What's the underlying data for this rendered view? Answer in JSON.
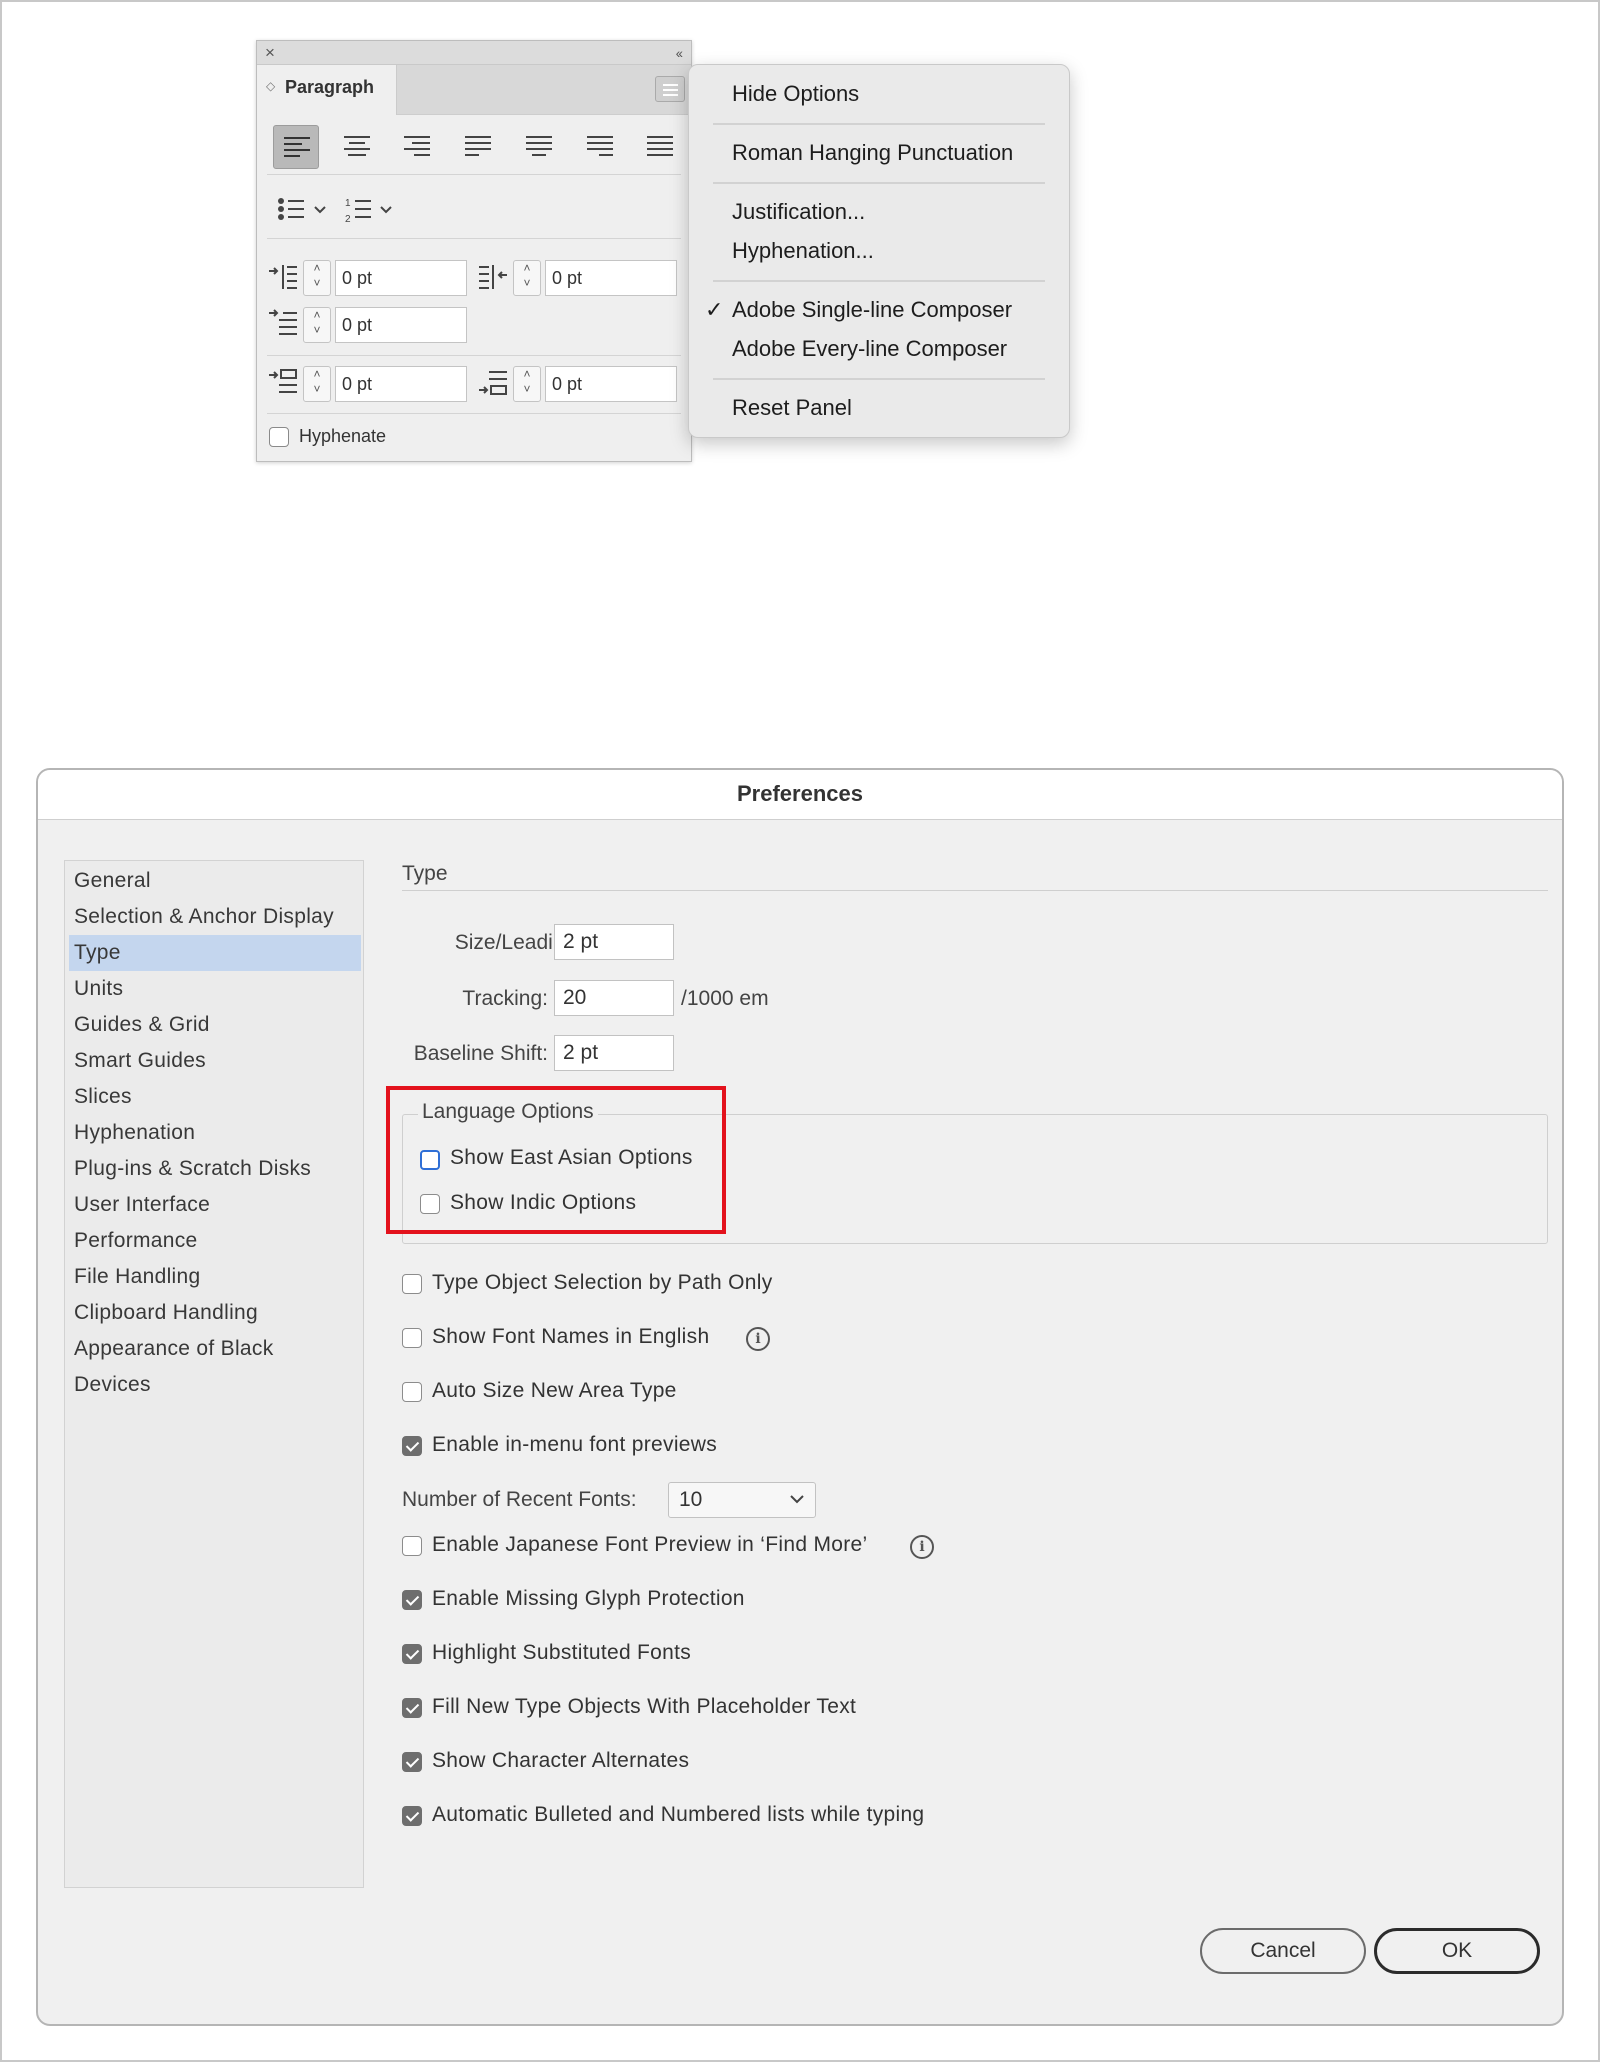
{
  "paragraph_panel": {
    "close_icon": "close-icon",
    "collapse_icon": "collapse-double-chevron-icon",
    "tab_label": "Paragraph",
    "menu_button_icon": "hamburger-menu-icon",
    "alignments": [
      "align-left",
      "align-center",
      "align-right",
      "justify-last-left",
      "justify-last-center",
      "justify-last-right",
      "justify-all"
    ],
    "active_alignment": "align-left",
    "left_indent": "0 pt",
    "right_indent": "0 pt",
    "first_line_indent": "0 pt",
    "space_before": "0 pt",
    "space_after": "0 pt",
    "hyphenate_label": "Hyphenate",
    "hyphenate_checked": false
  },
  "flyout_menu": {
    "hide_options": "Hide Options",
    "roman_hanging": "Roman Hanging Punctuation",
    "justification": "Justification...",
    "hyphenation": "Hyphenation...",
    "single_line": "Adobe Single-line Composer",
    "single_line_check": "✓",
    "every_line": "Adobe Every-line Composer",
    "reset_panel": "Reset Panel"
  },
  "preferences": {
    "title": "Preferences",
    "sidebar": [
      "General",
      "Selection & Anchor Display",
      "Type",
      "Units",
      "Guides & Grid",
      "Smart Guides",
      "Slices",
      "Hyphenation",
      "Plug-ins & Scratch Disks",
      "User Interface",
      "Performance",
      "File Handling",
      "Clipboard Handling",
      "Appearance of Black",
      "Devices"
    ],
    "selected_section": "Type",
    "section_label": "Type",
    "size_leading_label": "Size/Leading:",
    "size_leading_value": "2 pt",
    "tracking_label": "Tracking:",
    "tracking_value": "20",
    "tracking_unit": "/1000 em",
    "baseline_shift_label": "Baseline Shift:",
    "baseline_shift_value": "2 pt",
    "language_options": {
      "legend": "Language Options",
      "show_east_asian": "Show East Asian Options",
      "show_indic": "Show Indic Options"
    },
    "options": {
      "type_object_selection": "Type Object Selection by Path Only",
      "show_font_names_english": "Show Font Names in English",
      "auto_size_area_type": "Auto Size New Area Type",
      "enable_font_previews": "Enable in-menu font previews",
      "recent_fonts_label": "Number of Recent Fonts:",
      "recent_fonts_value": "10",
      "japanese_preview": "Enable Japanese Font Preview in ‘Find More’",
      "missing_glyph": "Enable Missing Glyph Protection",
      "highlight_substituted": "Highlight Substituted Fonts",
      "fill_placeholder": "Fill New Type Objects With Placeholder Text",
      "character_alternates": "Show Character Alternates",
      "auto_bulleted": "Automatic Bulleted and Numbered lists while typing"
    },
    "checked": {
      "show_east_asian": false,
      "show_indic": false,
      "type_object_selection": false,
      "show_font_names_english": false,
      "auto_size_area_type": false,
      "enable_font_previews": true,
      "japanese_preview": false,
      "missing_glyph": true,
      "highlight_substituted": true,
      "fill_placeholder": true,
      "character_alternates": true,
      "auto_bulleted": true
    },
    "cancel_label": "Cancel",
    "ok_label": "OK",
    "info_glyph": "i",
    "highlight_color": "#e3121c",
    "selection_color": "#c4d6ee"
  }
}
